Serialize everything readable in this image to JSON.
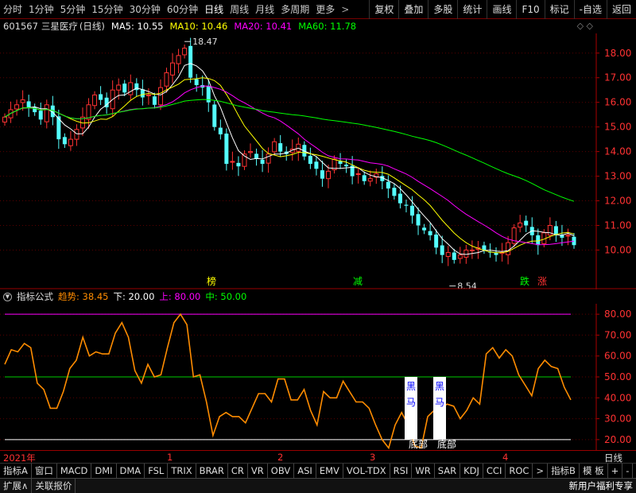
{
  "toolbar": {
    "timeframes": [
      "分时",
      "1分钟",
      "5分钟",
      "15分钟",
      "30分钟",
      "60分钟",
      "日线",
      "周线",
      "月线",
      "多周期",
      "更多"
    ],
    "more_arrow": ">",
    "right_buttons": [
      "复权",
      "叠加",
      "多股",
      "统计",
      "画线",
      "F10",
      "标记",
      "-自选",
      "返回"
    ]
  },
  "info": {
    "code": "601567",
    "name": "三星医疗",
    "period": "(日线)",
    "ma5": "MA5: 10.55",
    "ma10": "MA10: 10.46",
    "ma20": "MA20: 10.41",
    "ma60": "MA60: 11.78",
    "diamonds": "◇ ◇"
  },
  "main_chart": {
    "price_ticks": [
      "18.00",
      "17.00",
      "16.00",
      "15.00",
      "14.00",
      "13.00",
      "12.00",
      "11.00",
      "10.00"
    ],
    "high_label": "18.47",
    "low_label": "8.54",
    "markers": [
      "榜",
      "减",
      "跌",
      "涨"
    ],
    "colors": {
      "up": "#ff3232",
      "down": "#54ffff",
      "ma5": "#ffffff",
      "ma10": "#ffff00",
      "ma20": "#ff00ff",
      "ma60": "#00ff00"
    }
  },
  "indicator": {
    "name": "指标公式",
    "trend_label": "趋势: 38.45",
    "lower_label": "下: 20.00",
    "upper_label": "上: 80.00",
    "mid_label": "中: 50.00",
    "ticks": [
      "80.00",
      "70.00",
      "60.00",
      "50.00",
      "40.00",
      "30.00",
      "20.00"
    ],
    "signals": [
      {
        "chars": [
          "黑",
          "马"
        ],
        "label": "底部"
      },
      {
        "chars": [
          "黑",
          "马"
        ],
        "label": "底部"
      }
    ],
    "colors": {
      "trend": "#ff8c00",
      "upper": "#ff00ff",
      "mid": "#00cc00",
      "lower": "#ffffff"
    }
  },
  "xaxis": {
    "year": "2021年",
    "months": [
      "1",
      "2",
      "3",
      "4"
    ],
    "right_label": "日线"
  },
  "tabs": [
    "指标A",
    "窗口",
    "MACD",
    "DMI",
    "DMA",
    "FSL",
    "TRIX",
    "BRAR",
    "CR",
    "VR",
    "OBV",
    "ASI",
    "EMV",
    "VOL-TDX",
    "RSI",
    "WR",
    "SAR",
    "KDJ",
    "CCI",
    "ROC",
    ">",
    "指标B",
    "模 板",
    "+",
    "-"
  ],
  "status": {
    "expand": "扩展∧",
    "linked": "关联报价",
    "promo": "新用户福利专享"
  },
  "chart_data": {
    "type": "line",
    "title": "601567 三星医疗 (日线)",
    "price": {
      "ylim": [
        8.4,
        18.8
      ],
      "closes": [
        15.4,
        15.7,
        15.9,
        16.1,
        15.8,
        15.6,
        15.3,
        15.9,
        15.4,
        14.5,
        14.3,
        14.5,
        14.9,
        15.4,
        15.9,
        16.3,
        16.1,
        15.8,
        16.5,
        16.7,
        16.4,
        16.8,
        16.5,
        16.2,
        16.3,
        15.9,
        16.6,
        17.2,
        17.6,
        17.9,
        18.2,
        17.0,
        16.7,
        16.6,
        16.0,
        15.0,
        14.7,
        13.5,
        13.6,
        13.4,
        13.9,
        14.0,
        13.7,
        13.5,
        13.9,
        14.4,
        14.0,
        13.9,
        14.1,
        14.3,
        13.8,
        13.5,
        13.3,
        12.9,
        13.2,
        13.7,
        13.5,
        13.4,
        13.0,
        13.1,
        12.8,
        12.9,
        13.1,
        12.8,
        12.5,
        12.2,
        11.9,
        11.8,
        11.4,
        11.0,
        10.8,
        10.6,
        10.1,
        9.8,
        9.9,
        9.6,
        9.8,
        10.0,
        10.0,
        10.1,
        10.0,
        9.9,
        9.8,
        9.9,
        10.3,
        10.9,
        11.1,
        11.0,
        10.6,
        10.2,
        10.7,
        11.0,
        10.6,
        10.5,
        10.6,
        10.2
      ],
      "high": 18.47,
      "low": 8.54,
      "ma_current": {
        "MA5": 10.55,
        "MA10": 10.46,
        "MA20": 10.41,
        "MA60": 11.78
      }
    },
    "indicator": {
      "ylim": [
        15,
        85
      ],
      "levels": {
        "upper": 80,
        "mid": 50,
        "lower": 20
      },
      "trend": [
        56,
        63,
        62,
        66,
        64,
        47,
        44,
        35,
        35,
        43,
        54,
        58,
        69,
        60,
        62,
        61,
        61,
        71,
        76,
        69,
        53,
        47,
        56,
        50,
        51,
        64,
        76,
        80,
        75,
        50,
        51,
        38,
        22,
        31,
        33,
        31,
        31,
        28,
        35,
        42,
        42,
        38,
        49,
        49,
        39,
        39,
        44,
        34,
        27,
        43,
        40,
        40,
        48,
        43,
        38,
        38,
        35,
        27,
        20,
        16,
        27,
        33,
        27,
        17,
        16,
        31,
        34,
        35,
        37,
        36,
        30,
        34,
        40,
        37,
        61,
        64,
        59,
        63,
        60,
        51,
        46,
        41,
        54,
        58,
        55,
        54,
        45,
        39
      ],
      "last": 38.45
    },
    "x_months": [
      "1",
      "2",
      "3",
      "4"
    ]
  }
}
